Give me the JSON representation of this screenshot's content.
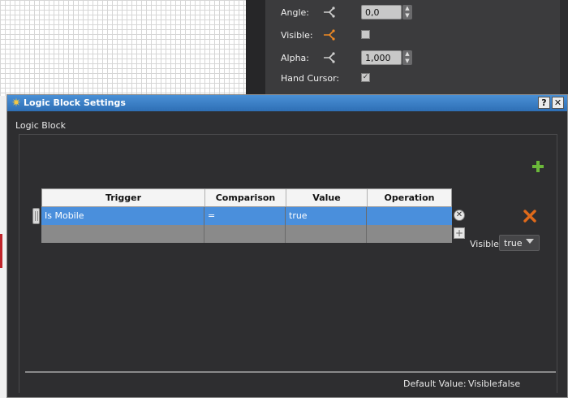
{
  "props": {
    "rows": [
      {
        "label": "Angle:",
        "value": "0,0",
        "kind": "spin",
        "icon_color": "#cfcfcf"
      },
      {
        "label": "Visible:",
        "kind": "check",
        "checked": false,
        "icon_color": "#f08a24"
      },
      {
        "label": "Alpha:",
        "value": "1,000",
        "kind": "spin",
        "icon_color": "#cfcfcf"
      },
      {
        "label": "Hand Cursor:",
        "kind": "check",
        "checked": true
      }
    ]
  },
  "dialog": {
    "title": "Logic Block Settings",
    "help_label": "?",
    "close_label": "✕",
    "group_title": "Logic Block",
    "table": {
      "headers": [
        "Trigger",
        "Comparison",
        "Value",
        "Operation"
      ],
      "rows": [
        {
          "trigger": "Is Mobile",
          "comparison": "=",
          "value": "true",
          "operation": ""
        }
      ]
    },
    "visible_label": "Visible:",
    "visible_value": "true",
    "footer_default_label": "Default Value:",
    "footer_visible_label": "Visible:",
    "footer_visible_value": "false",
    "accent_add": "#6bb83a",
    "accent_delete": "#e06a1a"
  }
}
